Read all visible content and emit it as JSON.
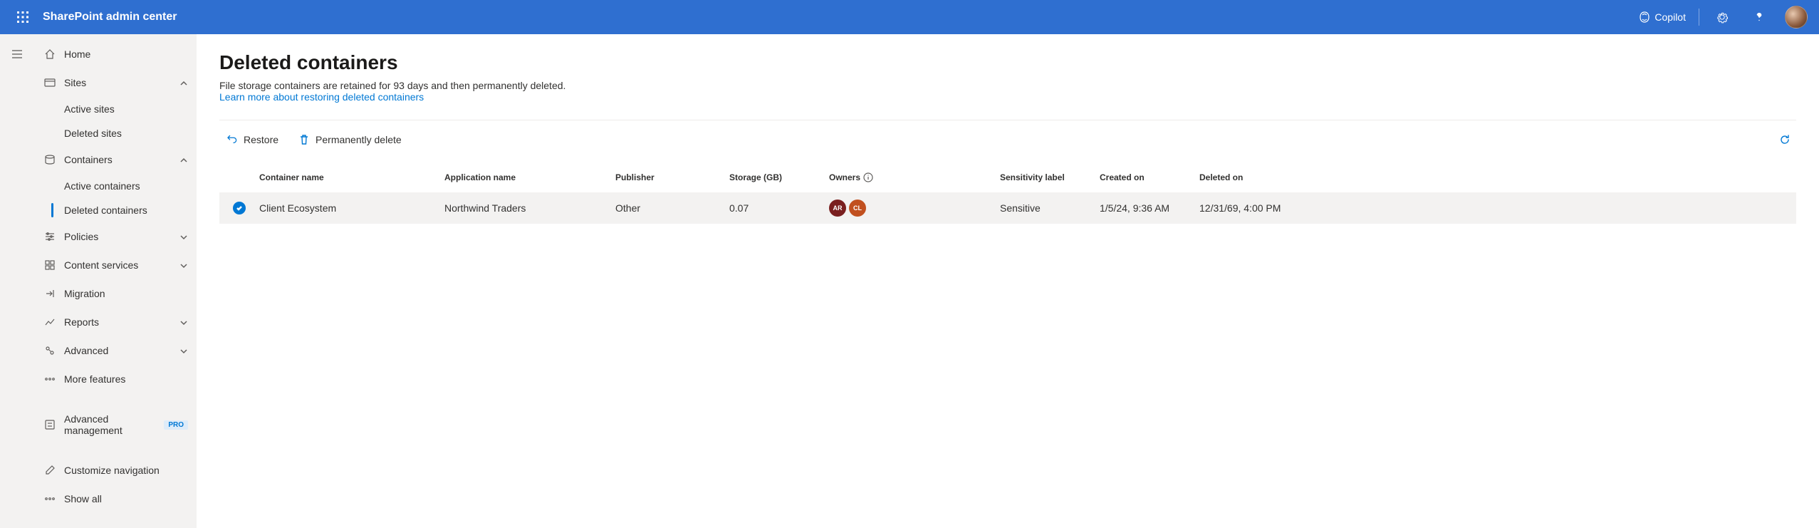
{
  "header": {
    "title": "SharePoint admin center",
    "copilot_label": "Copilot"
  },
  "nav": {
    "home": "Home",
    "sites": "Sites",
    "sites_children": {
      "active": "Active sites",
      "deleted": "Deleted sites"
    },
    "containers": "Containers",
    "containers_children": {
      "active": "Active containers",
      "deleted": "Deleted containers"
    },
    "policies": "Policies",
    "content_services": "Content services",
    "migration": "Migration",
    "reports": "Reports",
    "advanced": "Advanced",
    "more_features": "More features",
    "advanced_mgmt": "Advanced management",
    "pro_badge": "PRO",
    "customize": "Customize navigation",
    "show_all": "Show all"
  },
  "page": {
    "title": "Deleted containers",
    "description": "File storage containers are retained for 93 days and then permanently deleted.",
    "learn_more": "Learn more about restoring deleted containers"
  },
  "commands": {
    "restore": "Restore",
    "perm_delete": "Permanently delete"
  },
  "table": {
    "headers": {
      "container_name": "Container name",
      "application_name": "Application name",
      "publisher": "Publisher",
      "storage": "Storage (GB)",
      "owners": "Owners",
      "sensitivity": "Sensitivity label",
      "created_on": "Created on",
      "deleted_on": "Deleted on"
    },
    "rows": [
      {
        "selected": true,
        "container_name": "Client Ecosystem",
        "application_name": "Northwind Traders",
        "publisher": "Other",
        "storage": "0.07",
        "owners": [
          {
            "initials": "AR",
            "color": "#7a1f1f"
          },
          {
            "initials": "CL",
            "color": "#c1501f"
          }
        ],
        "sensitivity": "Sensitive",
        "created_on": "1/5/24, 9:36 AM",
        "deleted_on": "12/31/69, 4:00 PM"
      }
    ]
  }
}
